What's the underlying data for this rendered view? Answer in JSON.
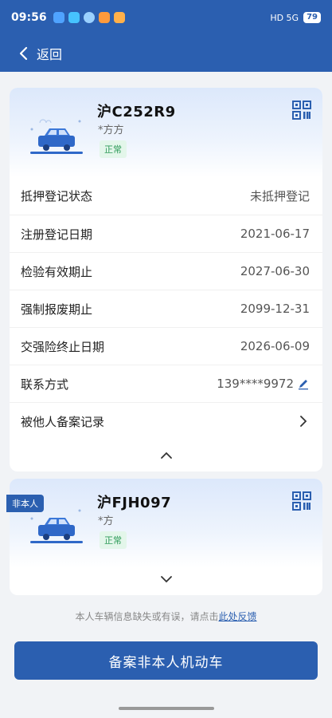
{
  "status_bar": {
    "time": "09:56",
    "battery": "79",
    "signal_text": "HD 5G"
  },
  "nav": {
    "back_label": "返回"
  },
  "vehicle_1": {
    "plate": "沪C252R9",
    "owner": "*方方",
    "status": "正常",
    "rows": [
      {
        "label": "抵押登记状态",
        "value": "未抵押登记"
      },
      {
        "label": "注册登记日期",
        "value": "2021-06-17"
      },
      {
        "label": "检验有效期止",
        "value": "2027-06-30"
      },
      {
        "label": "强制报废期止",
        "value": "2099-12-31"
      },
      {
        "label": "交强险终止日期",
        "value": "2026-06-09"
      },
      {
        "label": "联系方式",
        "value": "139****9972"
      },
      {
        "label": "被他人备案记录",
        "value": ""
      }
    ]
  },
  "vehicle_2": {
    "tag": "非本人",
    "plate": "沪FJH097",
    "owner": "*方",
    "status": "正常"
  },
  "footer": {
    "note": "本人车辆信息缺失或有误，请点击",
    "link": "此处反馈"
  },
  "primary_button": "备案非本人机动车",
  "colors": {
    "brand": "#2b5fb0",
    "ok_bg": "#e3f6ea",
    "ok_text": "#2e9b59"
  }
}
